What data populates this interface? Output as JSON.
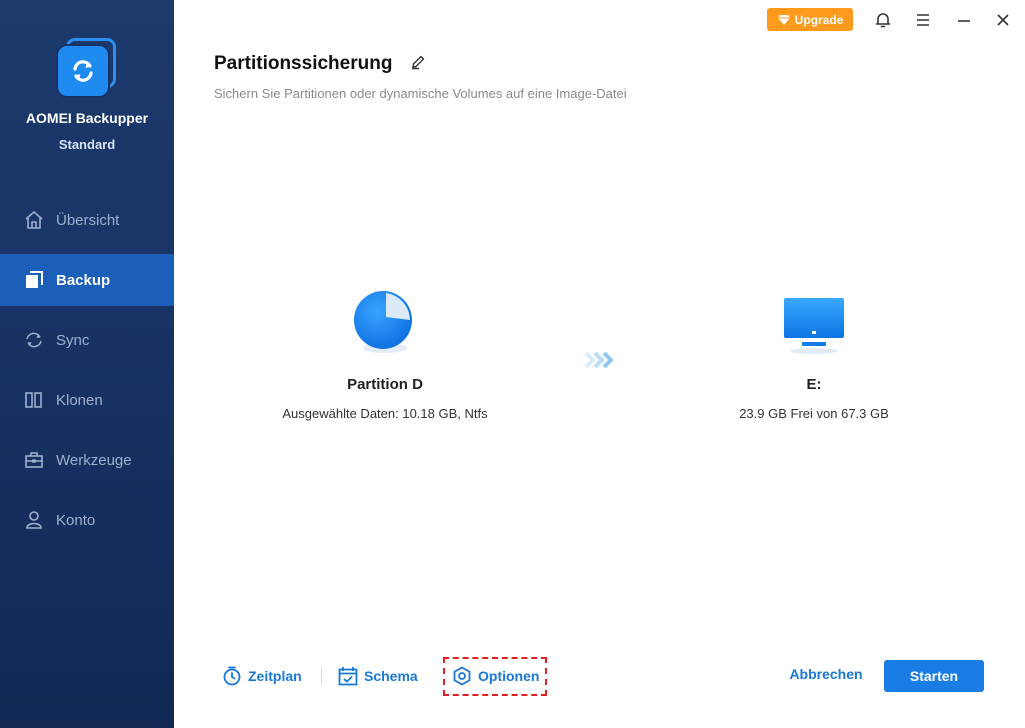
{
  "app": {
    "name": "AOMEI Backupper",
    "edition": "Standard"
  },
  "sidebar": {
    "items": [
      {
        "label": "Übersicht",
        "icon": "home-icon",
        "active": false
      },
      {
        "label": "Backup",
        "icon": "backup-icon",
        "active": true
      },
      {
        "label": "Sync",
        "icon": "sync-icon",
        "active": false
      },
      {
        "label": "Klonen",
        "icon": "clone-icon",
        "active": false
      },
      {
        "label": "Werkzeuge",
        "icon": "toolbox-icon",
        "active": false
      },
      {
        "label": "Konto",
        "icon": "user-icon",
        "active": false
      }
    ]
  },
  "topbar": {
    "upgrade_label": "Upgrade",
    "icons": [
      "diamond-icon",
      "bell-icon",
      "menu-icon",
      "minimize-icon",
      "close-icon"
    ]
  },
  "page": {
    "title": "Partitionssicherung",
    "subtitle": "Sichern Sie Partitionen oder dynamische Volumes auf eine Image-Datei"
  },
  "source": {
    "name": "Partition D",
    "info": "Ausgewählte Daten: 10.18 GB, Ntfs",
    "icon": "pie-chart-icon"
  },
  "destination": {
    "name": "E:",
    "info": "23.9 GB Frei von 67.3 GB",
    "icon": "monitor-icon"
  },
  "bottom": {
    "schedule_label": "Zeitplan",
    "scheme_label": "Schema",
    "options_label": "Optionen",
    "cancel_label": "Abbrechen",
    "start_label": "Starten"
  },
  "colors": {
    "sidebar_bg": "#173163",
    "active_item": "#1b5fb8",
    "accent": "#1a7de6",
    "upgrade": "#ff9a1d",
    "highlight_frame": "#e01f1f"
  }
}
